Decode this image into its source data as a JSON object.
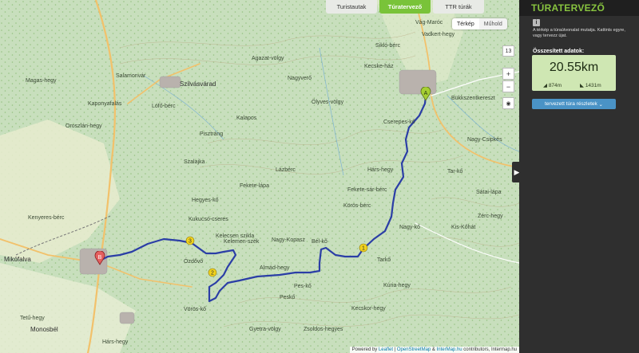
{
  "tabs": [
    {
      "label": "Turistautak",
      "active": false
    },
    {
      "label": "Túratervező",
      "active": true
    },
    {
      "label": "TTR túrák",
      "active": false
    }
  ],
  "map_type": {
    "terkep": "Térkép",
    "muhold": "Műhold"
  },
  "controls": {
    "zoom_level": "13",
    "zoom_in": "+",
    "zoom_out": "−",
    "locate": "◉"
  },
  "attribution": {
    "prefix": "Powered by",
    "leaflet": "Leaflet",
    "osm": "OpenStreetMap",
    "intermap": "InterMap.hu",
    "suffix": "contributors, Intermap.hu"
  },
  "sidebar": {
    "title": "TÚRATERVEZŐ",
    "info_icon": "i",
    "intro": "A térkép a túraútvonalat mutatja. Kattints egyre, vagy tervezz újat.",
    "summary_label": "Összesített adatok:",
    "distance": "20.55km",
    "ascent": "874m",
    "descent": "1431m",
    "details_button": "tervezett túra részletek",
    "collapse_icon": "▶"
  },
  "waypoints": {
    "start": "A",
    "end": "B",
    "w1": "1",
    "w2": "2",
    "w3": "3"
  },
  "labels": {
    "l1": "Vadkert-hegy",
    "l2": "Sikló-bérc",
    "l3": "Agazat-völgy",
    "l4": "Kecske-ház",
    "l5": "Magas-hegy",
    "l6": "Szilvásvárad",
    "l7": "Salamonvár",
    "l8": "Kaponyafalás",
    "l9": "Oroszlán-hegy",
    "l10": "Lófő-bérc",
    "l11": "Ölyves-völgy",
    "l12": "Nagyverő",
    "l13": "Kalapos",
    "l14": "Pisztráng",
    "l15": "Nagy-Csipkés",
    "l16": "Bükkszentkereszt",
    "l17": "Kelecsen szikla",
    "l18": "Ózdővő",
    "l19": "Kenyeres-bérc",
    "l20": "Mikófalva",
    "l21": "Bél-kő",
    "l22": "Almád-hegy",
    "l23": "Pes-kő",
    "l24": "Tetű-hegy",
    "l25": "Monosbél",
    "l26": "Hárs-hegy",
    "l27": "Gyetra-völgy",
    "l28": "Zsoldos-hegyes",
    "l29": "Kecskor-hegy",
    "l30": "Sátai-lápa",
    "l31": "Zérc-hegy",
    "l32": "Nagy-kő",
    "l33": "Fekete-sár-bérc",
    "l34": "Tarkő",
    "l35": "Kúria-hegy",
    "l36": "Kelemen-szék",
    "l37": "Nagy-Kopasz",
    "l38": "Hárs-hegy",
    "l39": "Kis-Kőhát",
    "l40": "Körös-bérc",
    "l41": "Vág-Maróc",
    "l42": "Peskő",
    "l43": "Lázbérc",
    "l44": "Kukucsó-cseres",
    "l45": "Tar-kő",
    "l46": "Fekete-lápa",
    "l47": "Vörös-kő",
    "l48": "Hegyes-kő",
    "l49": "Cserepes-kő",
    "l50": "Szalajka"
  }
}
